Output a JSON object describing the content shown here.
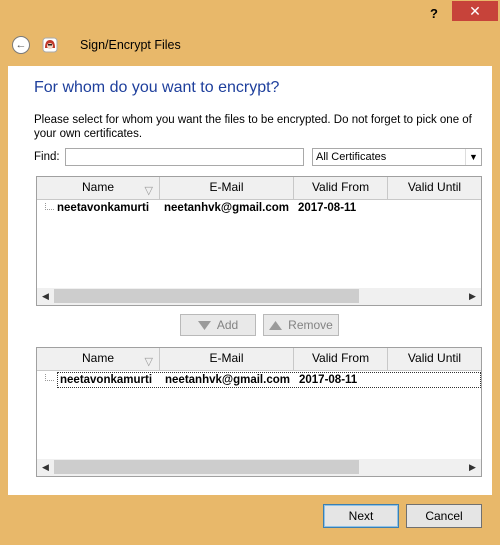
{
  "window": {
    "help_glyph": "?",
    "close_glyph": "✕",
    "title_bar_color": "#e8b86a",
    "close_color": "#c7433a"
  },
  "header": {
    "back_glyph": "←",
    "title": "Sign/Encrypt Files"
  },
  "page": {
    "heading": "For whom do you want to encrypt?",
    "description": "Please select for whom you want the files to be encrypted. Do not forget to pick one of your own certificates.",
    "find_label": "Find:",
    "find_value": "",
    "filter_selected": "All Certificates",
    "heading_color": "#1e3f9c"
  },
  "table_columns": [
    "Name",
    "E-Mail",
    "Valid From",
    "Valid Until"
  ],
  "available_table": {
    "rows": [
      {
        "name": "neetavonkamurti",
        "email": "neetanhvk@gmail.com",
        "valid_from": "2017-08-11"
      }
    ]
  },
  "selected_table": {
    "rows": [
      {
        "name": "neetavonkamurti",
        "email": "neetanhvk@gmail.com",
        "valid_from": "2017-08-11"
      }
    ]
  },
  "actions": {
    "add_label": "Add",
    "remove_label": "Remove"
  },
  "footer": {
    "next_label": "Next",
    "cancel_label": "Cancel"
  }
}
